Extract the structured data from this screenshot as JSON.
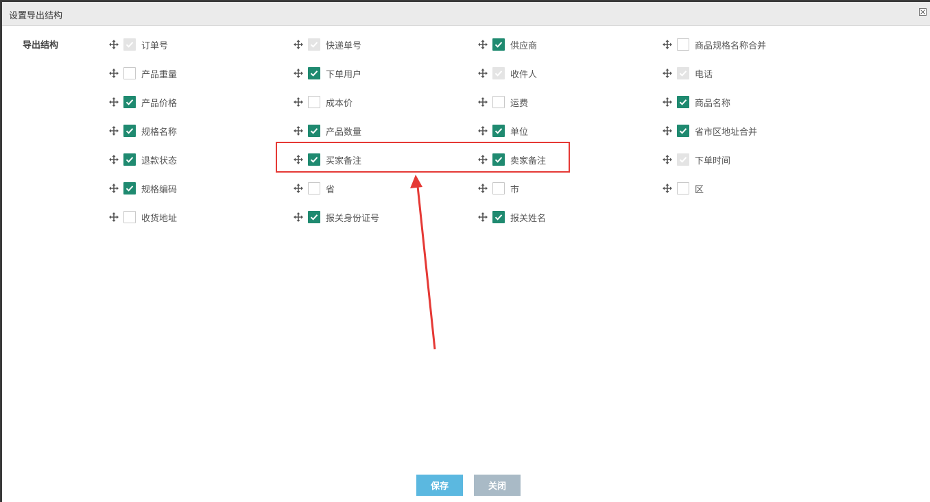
{
  "dialog": {
    "title": "设置导出结构",
    "close_icon": "close-x-icon"
  },
  "section_label": "导出结构",
  "fields": [
    {
      "label": "订单号",
      "state": "disabled"
    },
    {
      "label": "快递单号",
      "state": "disabled"
    },
    {
      "label": "供应商",
      "state": "checked"
    },
    {
      "label": "商品规格名称合并",
      "state": "unchecked"
    },
    {
      "label": "产品重量",
      "state": "unchecked"
    },
    {
      "label": "下单用户",
      "state": "checked"
    },
    {
      "label": "收件人",
      "state": "disabled"
    },
    {
      "label": "电话",
      "state": "disabled"
    },
    {
      "label": "产品价格",
      "state": "checked"
    },
    {
      "label": "成本价",
      "state": "unchecked"
    },
    {
      "label": "运费",
      "state": "unchecked"
    },
    {
      "label": "商品名称",
      "state": "checked"
    },
    {
      "label": "规格名称",
      "state": "checked"
    },
    {
      "label": "产品数量",
      "state": "checked"
    },
    {
      "label": "单位",
      "state": "checked"
    },
    {
      "label": "省市区地址合并",
      "state": "checked"
    },
    {
      "label": "退款状态",
      "state": "checked"
    },
    {
      "label": "买家备注",
      "state": "checked"
    },
    {
      "label": "卖家备注",
      "state": "checked"
    },
    {
      "label": "下单时间",
      "state": "disabled"
    },
    {
      "label": "规格编码",
      "state": "checked"
    },
    {
      "label": "省",
      "state": "unchecked"
    },
    {
      "label": "市",
      "state": "unchecked"
    },
    {
      "label": "区",
      "state": "unchecked"
    },
    {
      "label": "收货地址",
      "state": "unchecked"
    },
    {
      "label": "报关身份证号",
      "state": "checked"
    },
    {
      "label": "报关姓名",
      "state": "checked"
    }
  ],
  "buttons": {
    "save": "保存",
    "close": "关闭"
  },
  "colors": {
    "checked": "#1f8a70",
    "disabled": "#e4e4e4",
    "save_button": "#5bb8e0",
    "close_button": "#a9bac6",
    "annotation": "#e53935"
  }
}
